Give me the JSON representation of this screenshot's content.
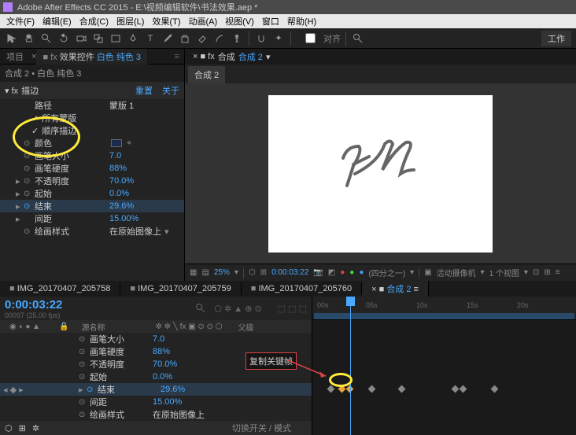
{
  "title": "Adobe After Effects CC 2015 - E:\\视频编辑软件\\书法效果.aep *",
  "menu": [
    "文件(F)",
    "编辑(E)",
    "合成(C)",
    "图层(L)",
    "效果(T)",
    "动画(A)",
    "视图(V)",
    "窗口",
    "帮助(H)"
  ],
  "toolbar_label": "对齐",
  "workspace_btn": "工作",
  "left_tabs": {
    "project": "项目",
    "fx": "效果控件",
    "fx_target": "白色 纯色 3"
  },
  "subtitle": "合成 2 • 白色 纯色 3",
  "fx": {
    "name": "描边",
    "reset": "重置",
    "about": "关于"
  },
  "props": [
    {
      "name": "路径",
      "val": "蒙版 1"
    },
    {
      "name": "所有蒙版",
      "check": true,
      "sub": true
    },
    {
      "name": "顺序描边",
      "check": true,
      "sub": true
    },
    {
      "name": "颜色",
      "swatch": true
    },
    {
      "name": "画笔大小",
      "val": "7.0",
      "kf": true,
      "blue": true
    },
    {
      "name": "画笔硬度",
      "val": "88%",
      "kf": true,
      "blue": true
    },
    {
      "name": "不透明度",
      "val": "70.0%",
      "kf": true,
      "arrow": true,
      "blue": true
    },
    {
      "name": "起始",
      "val": "0.0%",
      "kf": true,
      "arrow": true,
      "blue": true
    },
    {
      "name": "结束",
      "val": "29.6%",
      "kf": true,
      "arrow": true,
      "hl": true,
      "blue": true
    },
    {
      "name": "间距",
      "val": "15.00%",
      "arrow": true,
      "blue": true
    },
    {
      "name": "绘画样式",
      "val": "在原始图像上",
      "dd": true
    }
  ],
  "comp_tab": {
    "prefix": "合成",
    "name": "合成 2"
  },
  "comp_name": "合成 2",
  "viewer": {
    "zoom": "25%",
    "time": "0:00:03:22",
    "res": "(四分之一)",
    "camera": "活动摄像机",
    "views": "1 个视图"
  },
  "tl_tabs": [
    "IMG_20170407_205758",
    "IMG_20170407_205759",
    "IMG_20170407_205760"
  ],
  "tl_active": {
    "prefix": "",
    "name": "合成 2"
  },
  "timecode": "0:00:03:22",
  "fps": "00097 (25.00 fps)",
  "cols": {
    "source": "源名称",
    "parent": "父级"
  },
  "tl_props": [
    {
      "name": "画笔大小",
      "val": "7.0"
    },
    {
      "name": "画笔硬度",
      "val": "88%"
    },
    {
      "name": "不透明度",
      "val": "70.0%"
    },
    {
      "name": "起始",
      "val": "0.0%"
    },
    {
      "name": "结束",
      "val": "29.6%",
      "kf": true,
      "hl": true
    },
    {
      "name": "间距",
      "val": "15.00%"
    },
    {
      "name": "绘画样式",
      "val": "在原始图像上"
    }
  ],
  "toggle_label": "切换开关 / 模式",
  "ruler": [
    "00s",
    "05s",
    "10s",
    "15s",
    "20s"
  ],
  "annotation": "复制关键帧"
}
